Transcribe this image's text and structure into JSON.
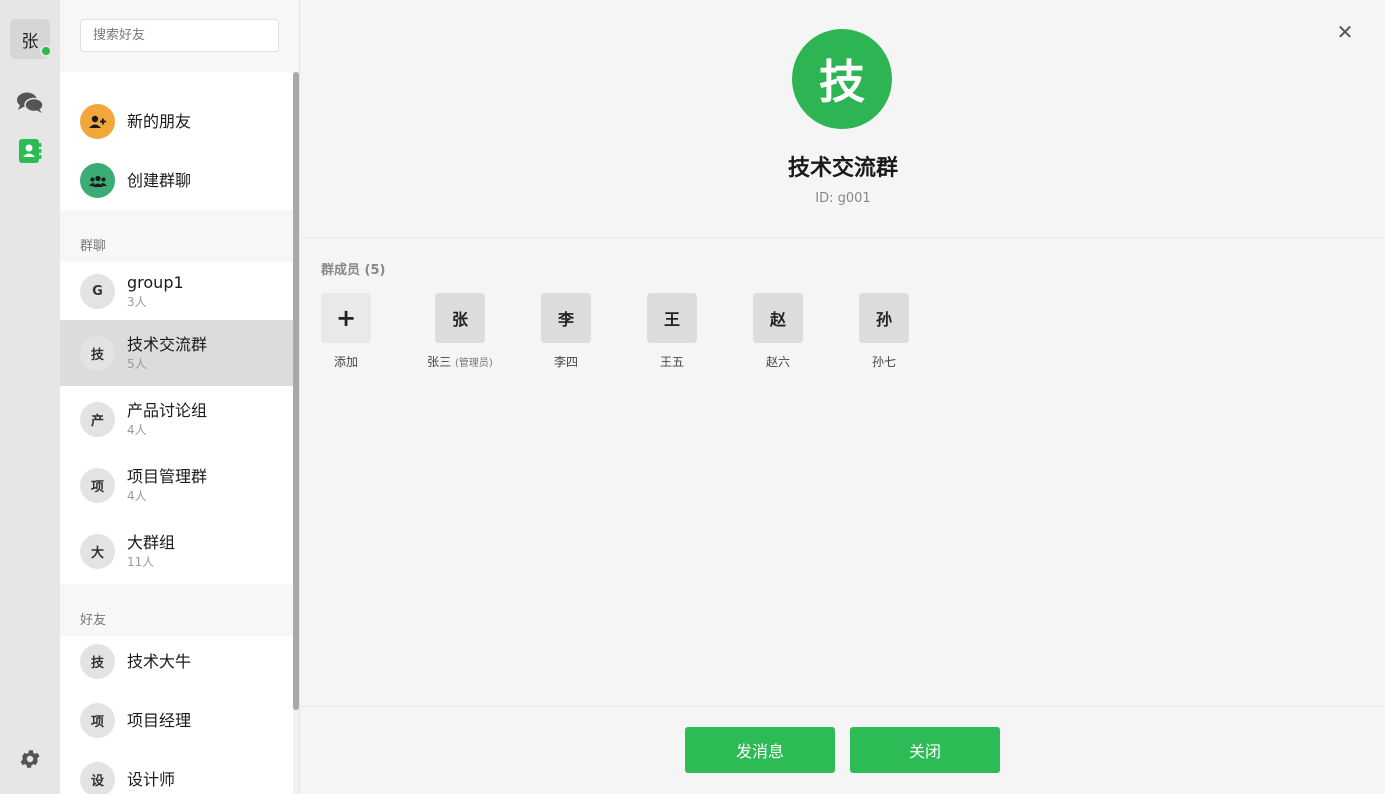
{
  "user": {
    "avatar_char": "张",
    "online_color": "#2fb84f"
  },
  "search": {
    "placeholder": "搜索好友"
  },
  "actions": [
    {
      "label": "新的朋友",
      "icon": "add-user-icon",
      "color": "#f3a73b"
    },
    {
      "label": "创建群聊",
      "icon": "group-icon",
      "color": "#3bac74"
    }
  ],
  "sections": {
    "groups": "群聊",
    "friends": "好友"
  },
  "groups": [
    {
      "avatar": "G",
      "name": "group1",
      "count": "3人"
    },
    {
      "avatar": "技",
      "name": "技术交流群",
      "count": "5人",
      "selected": true
    },
    {
      "avatar": "产",
      "name": "产品讨论组",
      "count": "4人"
    },
    {
      "avatar": "项",
      "name": "项目管理群",
      "count": "4人"
    },
    {
      "avatar": "大",
      "name": "大群组",
      "count": "11人"
    }
  ],
  "friends": [
    {
      "avatar": "技",
      "name": "技术大牛"
    },
    {
      "avatar": "项",
      "name": "项目经理"
    },
    {
      "avatar": "设",
      "name": "设计师"
    }
  ],
  "detail": {
    "avatar_char": "技",
    "title": "技术交流群",
    "id_text": "ID: g001",
    "members_label": "群成员 (5)",
    "add_label": "添加",
    "add_glyph": "+",
    "members": [
      {
        "avatar": "张",
        "name": "张三",
        "role": "(管理员)"
      },
      {
        "avatar": "李",
        "name": "李四"
      },
      {
        "avatar": "王",
        "name": "王五"
      },
      {
        "avatar": "赵",
        "name": "赵六"
      },
      {
        "avatar": "孙",
        "name": "孙七"
      }
    ],
    "send_label": "发消息",
    "close_label": "关闭",
    "close_glyph": "✕"
  },
  "colors": {
    "accent": "#2dbb56",
    "group_avatar": "#2db554"
  }
}
